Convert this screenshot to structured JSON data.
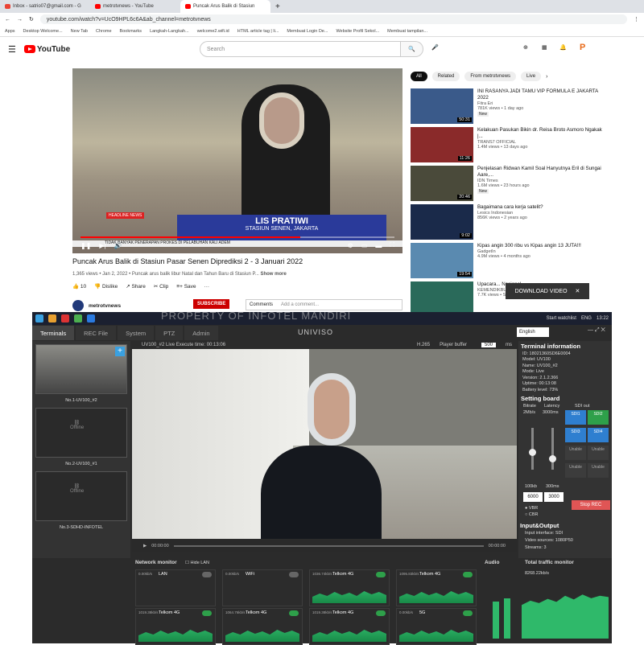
{
  "browser": {
    "tabs": [
      {
        "label": "Inbox - satrio07@gmail.com - G"
      },
      {
        "label": "metrotvnews - YouTube"
      },
      {
        "label": "Puncak Arus Balik di Stasiun"
      }
    ],
    "url": "youtube.com/watch?v=UcO9HPL6c6A&ab_channel=metrotvnews",
    "bookmarks": [
      "Apps",
      "Desktop Welcome...",
      "New Tab",
      "Chrome",
      "Bookmarks",
      "Langkah-Langkah...",
      "welcome2.wifi.id",
      "HTML article tag | li...",
      "Membuat Login De...",
      "Website Profil Sekol...",
      "Membuat tampilan..."
    ]
  },
  "youtube": {
    "logo": "YouTube",
    "search_placeholder": "Search",
    "video": {
      "headline_tag": "HEADLINE NEWS",
      "reporter_name": "LIS PRATIWI",
      "reporter_location": "STASIUN SENEN, JAKARTA",
      "ticker": "TIDAK BANYAK PENERAPAN PROKES DI PELABUHAN KALI ADEM",
      "progress": 0.7
    },
    "title": "Puncak Arus Balik di Stasiun Pasar Senen Diprediksi 2 - 3 Januari 2022",
    "meta": "1,365 views • Jan 2, 2022 • Puncak arus balik libur Natal dan Tahun Baru di Stasiun P...",
    "show_more": "Show more",
    "actions": {
      "likes": "10",
      "dislike": "Dislike",
      "share": "Share",
      "clip": "Clip",
      "save": "Save"
    },
    "channel": "metrotvnews",
    "subscribe": "SUBSCRIBE",
    "comments_label": "Comments",
    "comment_placeholder": "Add a comment...",
    "chips": [
      "All",
      "Related",
      "From metrotvnews",
      "Live"
    ],
    "recommendations": [
      {
        "title": "INI RASANYA JADI TAMU VIP FORMULA E JAKARTA 2022",
        "channel": "Fitra Eri",
        "views": "781K views • 1 day ago",
        "badge": "New",
        "duration": "50:31",
        "color": "#3a5a8a"
      },
      {
        "title": "Kelakuan Pasukan Bikin dr. Reisa Broto Asmoro Ngakak |...",
        "channel": "TRANS7 OFFICIAL",
        "views": "1.4M views • 13 days ago",
        "badge": "",
        "duration": "11:26",
        "color": "#8a2a2a"
      },
      {
        "title": "Penjelasan Ridwan Kamil Soal Hanyutnya Eril di Sungai Aare,...",
        "channel": "IDN Times",
        "views": "1.6M views • 23 hours ago",
        "badge": "New",
        "duration": "20:46",
        "color": "#4a4a3a"
      },
      {
        "title": "Bagaimana cara kerja satelit?",
        "channel": "Lesics Indonesian",
        "views": "856K views • 2 years ago",
        "badge": "",
        "duration": "9:02",
        "color": "#1a2a4a"
      },
      {
        "title": "Kipas angin 300 ribu vs Kipas angin 13 JUTA!!!",
        "channel": "GadgetIn",
        "views": "4.9M views • 4 months ago",
        "badge": "",
        "duration": "19:54",
        "color": "#5a8ab0"
      },
      {
        "title": "Upacara... Nasional...",
        "channel": "KEMENDIKBUD RI",
        "views": "7.7K views • Streamed 1 year ago",
        "badge": "",
        "duration": "",
        "color": "#2a6a5a"
      }
    ],
    "download_popup": "DOWNLOAD VIDEO"
  },
  "taskbar": {
    "start_watch": "Start watchlist",
    "lang": "ENG",
    "time": "13:22"
  },
  "watermark": "PROPERTY OF INFOTEL MANDIRI",
  "app": {
    "brand": "UNIVISO",
    "tabs": [
      "Terminals",
      "REC File",
      "System",
      "PTZ",
      "Admin"
    ],
    "language": "English",
    "terminals": [
      {
        "name": "No.1-UV100_#2",
        "state": "live"
      },
      {
        "name": "No.2-UV100_#1",
        "state": "Offline"
      },
      {
        "name": "No.3-SDHD-INFOTEL",
        "state": "Offline"
      }
    ],
    "video_header": {
      "left": "UV100_#2 Live Execute time: 00:13:06",
      "codec": "H.265",
      "buffer_label": "Player buffer",
      "buffer_value": "500",
      "unit": "ms"
    },
    "timeline": {
      "start": "00:00:00",
      "end": "00:00:00"
    },
    "terminal_info": {
      "header": "Terminal information",
      "lines": [
        "ID: 18021360SD6E0004",
        "Model: UV100",
        "Name: UV100_#2",
        "Mode: Live",
        "Version: 2.1.2.366",
        "Uptime: 00:13:08",
        "Battery level: 73%"
      ]
    },
    "setting_board": {
      "header": "Setting board",
      "bitrate_label": "Bitrate",
      "bitrate_value": "2Mb/s",
      "latency_label": "Latency",
      "latency_value": "3000ms",
      "bitrate_min": "100kb",
      "latency_min": "300ms",
      "bitrate_input": "6000",
      "latency_input": "3000",
      "vbr": "VBR",
      "cbr": "CBR",
      "sdi_out": "SDI out",
      "sdi": [
        "SDI1",
        "SDI2",
        "SDI3",
        "SDI4"
      ],
      "unable": "Unable",
      "stop_rec": "Stop REC"
    },
    "input_output": {
      "header": "Input&Output",
      "lines": [
        "Input interface: SDI",
        "Video sources: 1080P50",
        "Streams: 3"
      ]
    },
    "network": {
      "header": "Network monitor",
      "hide_lan": "Hide LAN",
      "cells": [
        {
          "name": "LAN",
          "rate": "0.00kb/s",
          "on": false
        },
        {
          "name": "WiFi",
          "rate": "0.00kb/s",
          "on": false
        },
        {
          "name": "Telkom 4G",
          "rate": "1036.74kb/s",
          "on": true
        },
        {
          "name": "Telkom 4G",
          "rate": "1095.83kb/s",
          "on": true
        },
        {
          "name": "Telkom 4G",
          "rate": "1019.38kb/s",
          "on": true
        },
        {
          "name": "Telkom 4G",
          "rate": "1064.76kb/s",
          "on": true
        },
        {
          "name": "Telkom 4G",
          "rate": "1019.38kb/s",
          "on": true
        },
        {
          "name": "5G",
          "rate": "0.00kb/s",
          "on": true
        }
      ]
    },
    "audio": {
      "header": "Audio",
      "levels": [
        0.55,
        0.6
      ]
    },
    "total_traffic": {
      "header": "Total traffic monitor",
      "rate": "8268.22kb/s"
    }
  }
}
